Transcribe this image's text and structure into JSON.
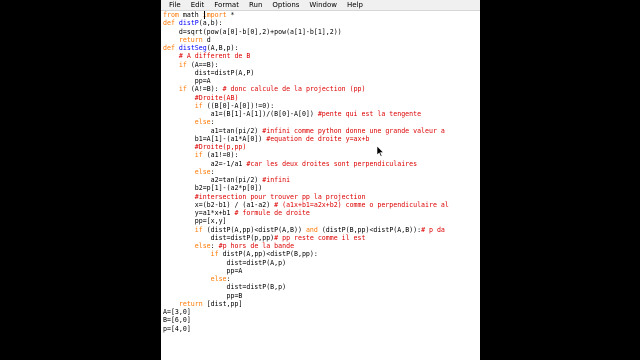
{
  "menubar": {
    "items": [
      "File",
      "Edit",
      "Format",
      "Run",
      "Options",
      "Window",
      "Help"
    ]
  },
  "colors": {
    "keyword": "#ff7700",
    "function_name": "#0000ff",
    "comment": "#dd0000",
    "string": "#00aa00",
    "text": "#000000"
  },
  "code": [
    [
      [
        "kw",
        "from"
      ],
      [
        "tx",
        " math "
      ],
      [
        "kw",
        "import"
      ],
      [
        "tx",
        " *"
      ]
    ],
    [
      [
        "kw",
        "def"
      ],
      [
        "tx",
        " "
      ],
      [
        "fn",
        "distP"
      ],
      [
        "tx",
        "(a,b):"
      ]
    ],
    [
      [
        "tx",
        "    d=sqrt(pow(a[0]-b[0],2)+pow(a[1]-b[1],2))"
      ]
    ],
    [
      [
        "tx",
        "    "
      ],
      [
        "kw",
        "return"
      ],
      [
        "tx",
        " d"
      ]
    ],
    [
      [
        "kw",
        "def"
      ],
      [
        "tx",
        " "
      ],
      [
        "fn",
        "distSeg"
      ],
      [
        "tx",
        "(A,B,p):"
      ]
    ],
    [
      [
        "tx",
        "    "
      ],
      [
        "cm",
        "# A different de B"
      ]
    ],
    [
      [
        "tx",
        "    "
      ],
      [
        "kw",
        "if"
      ],
      [
        "tx",
        " (A==B):"
      ]
    ],
    [
      [
        "tx",
        "        dist=distP(A,P)"
      ]
    ],
    [
      [
        "tx",
        "        pp=A"
      ]
    ],
    [
      [
        "tx",
        "    "
      ],
      [
        "kw",
        "if"
      ],
      [
        "tx",
        " (A!=B): "
      ],
      [
        "cm",
        "# donc calcule de la projection (pp)"
      ]
    ],
    [
      [
        "tx",
        "        "
      ],
      [
        "cm",
        "#Droite(AB)"
      ]
    ],
    [
      [
        "tx",
        "        "
      ],
      [
        "kw",
        "if"
      ],
      [
        "tx",
        " ((B[0]-A[0])!=0):"
      ]
    ],
    [
      [
        "tx",
        "            a1=(B[1]-A[1])/(B[0]-A[0]) "
      ],
      [
        "cm",
        "#pente qui est la tengente"
      ]
    ],
    [
      [
        "tx",
        "        "
      ],
      [
        "kw",
        "else"
      ],
      [
        "tx",
        ":"
      ]
    ],
    [
      [
        "tx",
        "            a1=tan(pi/2) "
      ],
      [
        "cm",
        "#infini comme python donne une grande valeur a"
      ]
    ],
    [
      [
        "tx",
        "        b1=A[1]-(a1*A[0]) "
      ],
      [
        "cm",
        "#equation de droite y=ax+b"
      ]
    ],
    [
      [
        "tx",
        "        "
      ],
      [
        "cm",
        "#Droite(p,pp)"
      ]
    ],
    [
      [
        "tx",
        "        "
      ],
      [
        "kw",
        "if"
      ],
      [
        "tx",
        " (a1!=0):"
      ]
    ],
    [
      [
        "tx",
        "            a2=-1/a1 "
      ],
      [
        "cm",
        "#car les deux droites sont perpendiculaires"
      ]
    ],
    [
      [
        "tx",
        "        "
      ],
      [
        "kw",
        "else"
      ],
      [
        "tx",
        ":"
      ]
    ],
    [
      [
        "tx",
        "            a2=tan(pi/2) "
      ],
      [
        "cm",
        "#infini"
      ]
    ],
    [
      [
        "tx",
        "        b2=p[1]-(a2*p[0])"
      ]
    ],
    [
      [
        "tx",
        "        "
      ],
      [
        "cm",
        "#intersection pour trouver pp la projection"
      ]
    ],
    [
      [
        "tx",
        "        x=(b2-b1) / (a1-a2) "
      ],
      [
        "cm",
        "# (a1x+b1=a2x+b2) comme o perpendiculaire al"
      ]
    ],
    [
      [
        "tx",
        "        y=a1*x+b1 "
      ],
      [
        "cm",
        "# formule de droite"
      ]
    ],
    [
      [
        "tx",
        "        pp=[x,y]"
      ]
    ],
    [
      [
        "tx",
        "        "
      ],
      [
        "kw",
        "if"
      ],
      [
        "tx",
        " (distP(A,pp)<distP(A,B)) "
      ],
      [
        "kw",
        "and"
      ],
      [
        "tx",
        " (distP(B,pp)<distP(A,B)):"
      ],
      [
        "cm",
        "# p da"
      ]
    ],
    [
      [
        "tx",
        "            dist=distP(p,pp)"
      ],
      [
        "cm",
        "# pp reste comme il est"
      ]
    ],
    [
      [
        "tx",
        "        "
      ],
      [
        "kw",
        "else"
      ],
      [
        "tx",
        ": "
      ],
      [
        "cm",
        "#p hors de la bande"
      ]
    ],
    [
      [
        "tx",
        "            "
      ],
      [
        "kw",
        "if"
      ],
      [
        "tx",
        " distP(A,pp)<distP(B,pp):"
      ]
    ],
    [
      [
        "tx",
        "                dist=distP(A,p)"
      ]
    ],
    [
      [
        "tx",
        "                pp=A"
      ]
    ],
    [
      [
        "tx",
        "            "
      ],
      [
        "kw",
        "else"
      ],
      [
        "tx",
        ":"
      ]
    ],
    [
      [
        "tx",
        "                dist=distP(B,p)"
      ]
    ],
    [
      [
        "tx",
        "                pp=B"
      ]
    ],
    [
      [
        "tx",
        "    "
      ],
      [
        "kw",
        "return"
      ],
      [
        "tx",
        " [dist,pp]"
      ]
    ],
    [
      [
        "tx",
        "A=[3,0]"
      ]
    ],
    [
      [
        "tx",
        "B=[6,0]"
      ]
    ],
    [
      [
        "tx",
        "p=[4,0]"
      ]
    ]
  ]
}
